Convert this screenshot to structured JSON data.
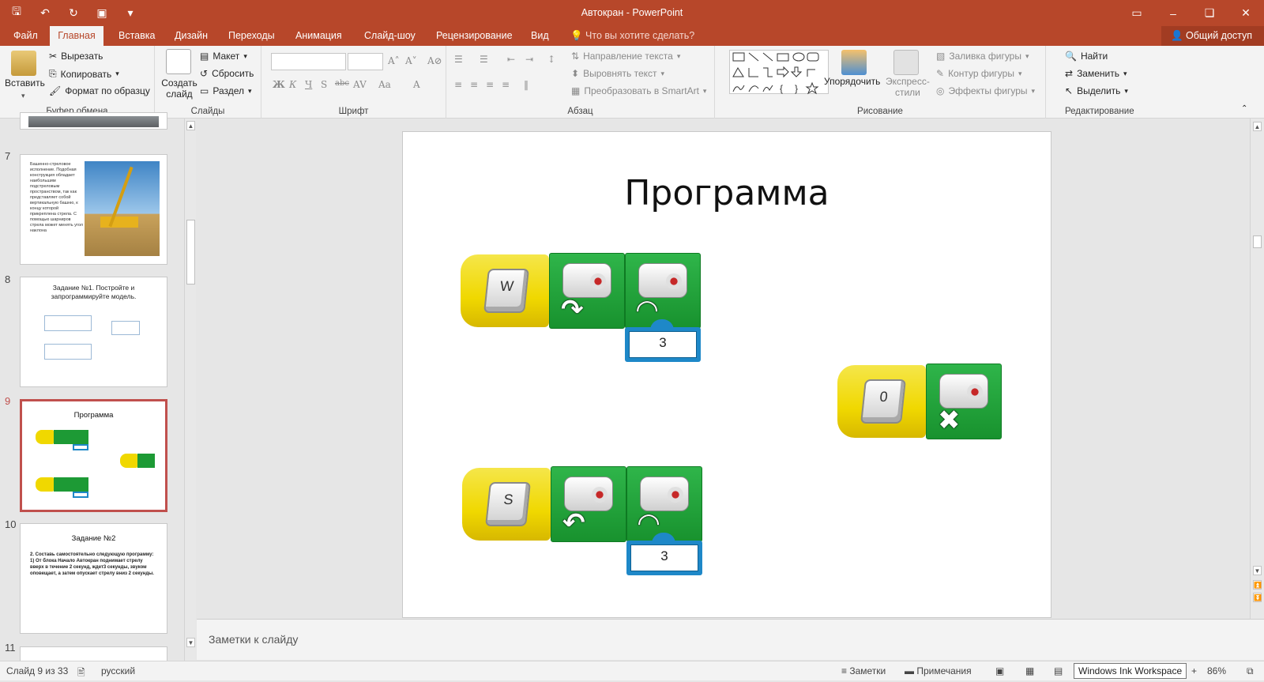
{
  "app": {
    "title": "Автокран - PowerPoint"
  },
  "tabs": {
    "file": "Файл",
    "home": "Главная",
    "insert": "Вставка",
    "design": "Дизайн",
    "transitions": "Переходы",
    "animation": "Анимация",
    "slideshow": "Слайд-шоу",
    "review": "Рецензирование",
    "view": "Вид",
    "tell_me": "Что вы хотите сделать?",
    "share": "Общий доступ"
  },
  "ribbon": {
    "clipboard": {
      "paste": "Вставить",
      "cut": "Вырезать",
      "copy": "Копировать",
      "format_painter": "Формат по образцу",
      "label": "Буфер обмена"
    },
    "slides": {
      "new_slide": "Создать слайд",
      "layout": "Макет",
      "reset": "Сбросить",
      "section": "Раздел",
      "label": "Слайды"
    },
    "font": {
      "label": "Шрифт"
    },
    "paragraph": {
      "text_direction": "Направление текста",
      "align_text": "Выровнять текст",
      "smartart": "Преобразовать в SmartArt",
      "label": "Абзац"
    },
    "drawing": {
      "arrange": "Упорядочить",
      "quick_styles": "Экспресс-стили",
      "fill": "Заливка фигуры",
      "outline": "Контур фигуры",
      "effects": "Эффекты фигуры",
      "label": "Рисование"
    },
    "editing": {
      "find": "Найти",
      "replace": "Заменить",
      "select": "Выделить",
      "label": "Редактирование"
    }
  },
  "thumbnails": {
    "s7": {
      "num": "7",
      "text": "Башенно-стреловое исполнение. Подобная конструкция обладает наибольшим подстреловым пространством, так как представляет собой вертикальную башню, к концу которой прикреплена стрела. С помощью шарниров стрела может менять угол наклона"
    },
    "s8": {
      "num": "8",
      "title": "Задание №1. Постройте и запрограммируйте модель."
    },
    "s9": {
      "num": "9",
      "title": "Программа"
    },
    "s10": {
      "num": "10",
      "title": "Задание №2",
      "body": "2. Составь самостоятельно следующую программу: 1) От блока Начало Автокран поднимает стрелу вверх в течение 2 секунд, ждет3 секунды, звуком оповещает, а затем опускает стрелу вниз 2 секунды."
    },
    "s11": {
      "num": "11"
    }
  },
  "slide": {
    "title": "Программа",
    "row1": {
      "key": "W",
      "value": "3"
    },
    "row2": {
      "key": "0"
    },
    "row3": {
      "key": "S",
      "value": "3"
    }
  },
  "notes": {
    "placeholder": "Заметки к слайду"
  },
  "status": {
    "slide_info": "Слайд 9 из 33",
    "language": "русский",
    "notes": "Заметки",
    "comments": "Примечания",
    "ink": "Windows Ink Workspace",
    "zoom": "86%"
  }
}
